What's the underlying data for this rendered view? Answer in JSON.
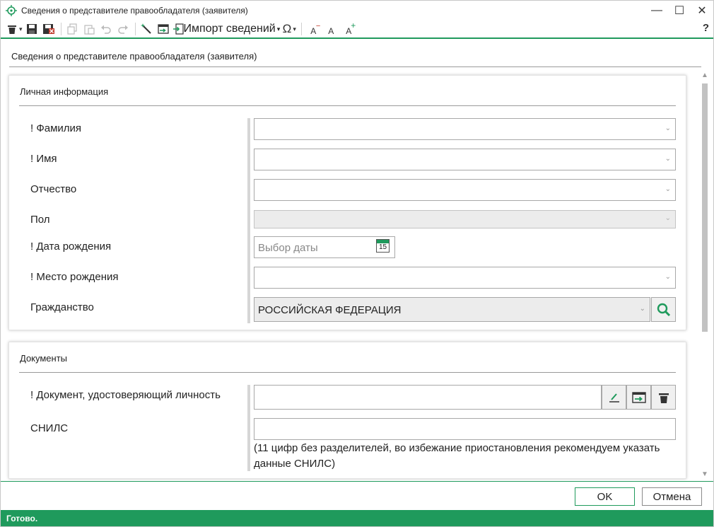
{
  "window": {
    "title": "Сведения о представителе правообладателя (заявителя)",
    "controls": {
      "minimize": "—",
      "maximize": "☐",
      "close": "✕"
    }
  },
  "toolbar": {
    "import_label": "Импорт сведений",
    "omega_label": "Ω",
    "help_label": "?",
    "font_small": "A",
    "font_reset": "A",
    "font_large": "A"
  },
  "page": {
    "heading": "Сведения о представителе правообладателя (заявителя)"
  },
  "personal": {
    "section_title": "Личная информация",
    "fields": [
      {
        "label": "! Фамилия",
        "value": ""
      },
      {
        "label": "! Имя",
        "value": ""
      },
      {
        "label": "Отчество",
        "value": ""
      },
      {
        "label": "Пол",
        "value": ""
      },
      {
        "label": "! Дата рождения",
        "placeholder": "Выбор даты",
        "calendar_day": "15"
      },
      {
        "label": "! Место рождения",
        "value": ""
      },
      {
        "label": "Гражданство",
        "value": "РОССИЙСКАЯ ФЕДЕРАЦИЯ"
      }
    ]
  },
  "documents": {
    "section_title": "Документы",
    "fields": [
      {
        "label": "! Документ, удостоверяющий личность",
        "value": ""
      },
      {
        "label": "СНИЛС",
        "value": ""
      }
    ],
    "snils_hint": "(11 цифр без разделителей, во избежание приостановления рекомендуем указать данные СНИЛС)"
  },
  "buttons": {
    "ok": "OK",
    "cancel": "Отмена"
  },
  "status": {
    "text": "Готово."
  },
  "colors": {
    "accent": "#1f9a5c"
  }
}
